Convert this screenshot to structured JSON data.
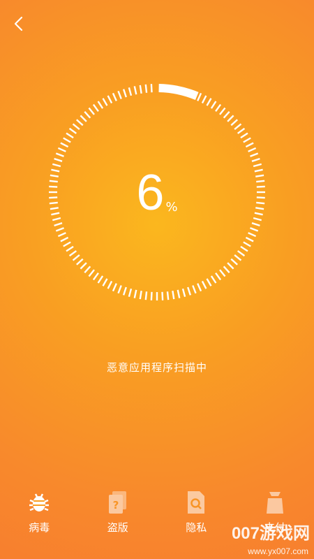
{
  "scan": {
    "percent": "6",
    "unit": "%",
    "progress": 0.06,
    "status": "恶意应用程序扫描中"
  },
  "tabs": [
    {
      "label": "病毒",
      "icon": "bug-icon"
    },
    {
      "label": "盗版",
      "icon": "question-file-icon"
    },
    {
      "label": "隐私",
      "icon": "search-file-icon"
    },
    {
      "label": "支付",
      "icon": "wallet-icon"
    }
  ],
  "watermark": {
    "text": "007游戏网",
    "sub": "www.yx007.com"
  },
  "colors": {
    "bg_center": "#fbb71e",
    "bg_edge": "#f77f2e",
    "tick": "#ffffff"
  }
}
